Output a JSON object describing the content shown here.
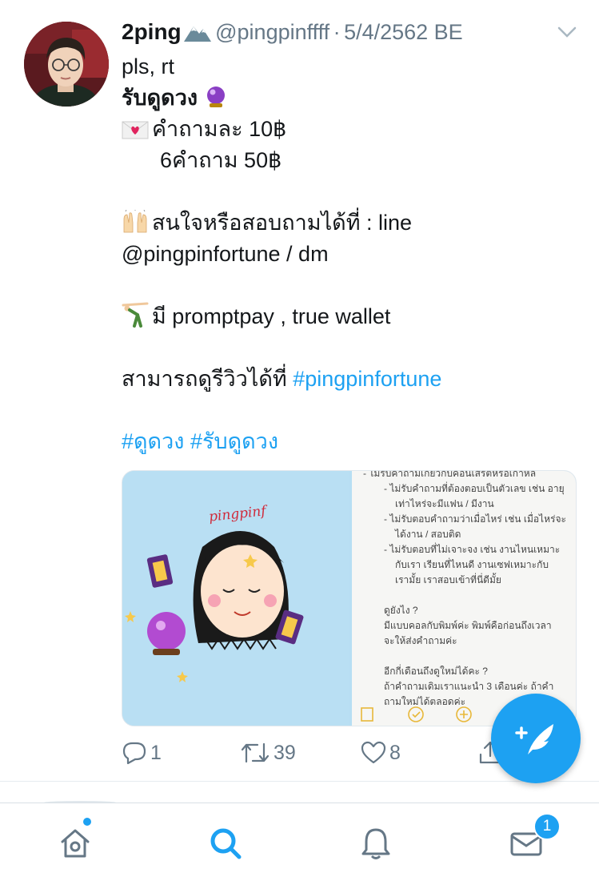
{
  "tweet": {
    "display_name": "2ping",
    "handle": "@pingpinffff",
    "separator": "·",
    "date": "5/4/2562 BE",
    "lines": {
      "l1": "pls, rt",
      "l2": "รับดูดวง",
      "l3": "คำถามละ 10฿",
      "l4": "6คำถาม 50฿",
      "l5": "สนใจหรือสอบถามได้ที่ : line",
      "l6": "@pingpinfortune / dm",
      "l7": "มี promptpay , true wallet",
      "l8_text": "สามารถดูรีวิวได้ที่ ",
      "l8_link": "#pingpinfortune",
      "l9_link1": "#ดูดวง",
      "l9_link2": "#รับดูดวง"
    },
    "media": {
      "brand_text": "pingpinf",
      "notes": [
        "- ไม่รับคำถามเกี่ยวกับคอนเสิร์ตหรือเกาหลี",
        "- ไม่รับคำถามที่ต้องตอบเป็นตัวเลข เช่น อายุ",
        "เท่าไหร่จะมีแฟน / มีงาน",
        "- ไม่รับตอบคำถามว่าเมื่อไหร่ เช่น เมื่อไหร่จะ",
        "ได้งาน / สอบติด",
        "- ไม่รับตอบที่ไม่เจาะจง เช่น งานไหนเหมาะ",
        "กับเรา เรียนที่ไหนดี งานเซฟเหมาะกับ",
        "เรามั้ย เราสอบเข้าที่นี่ดีมั้ย",
        "",
        "ดูยังไง ?",
        "มีแบบคอลกับพิมพ์ค่ะ พิมพ์คือก่อนถึงเวลา",
        "จะให้ส่งคำถามค่ะ",
        "",
        "อีกกี่เดือนถึงดูใหม่ได้คะ ?",
        "ถ้าคำถามเดิมเราแนะนำ 3 เดือนค่ะ ถ้าคำ",
        "ถามใหม่ได้ตลอดค่ะ"
      ]
    },
    "actions": {
      "replies": "1",
      "retweets": "39",
      "likes": "8"
    }
  },
  "tabbar": {
    "notification_badge": "1"
  },
  "colors": {
    "accent": "#1da1f2",
    "text": "#14171a",
    "secondary": "#657786"
  }
}
